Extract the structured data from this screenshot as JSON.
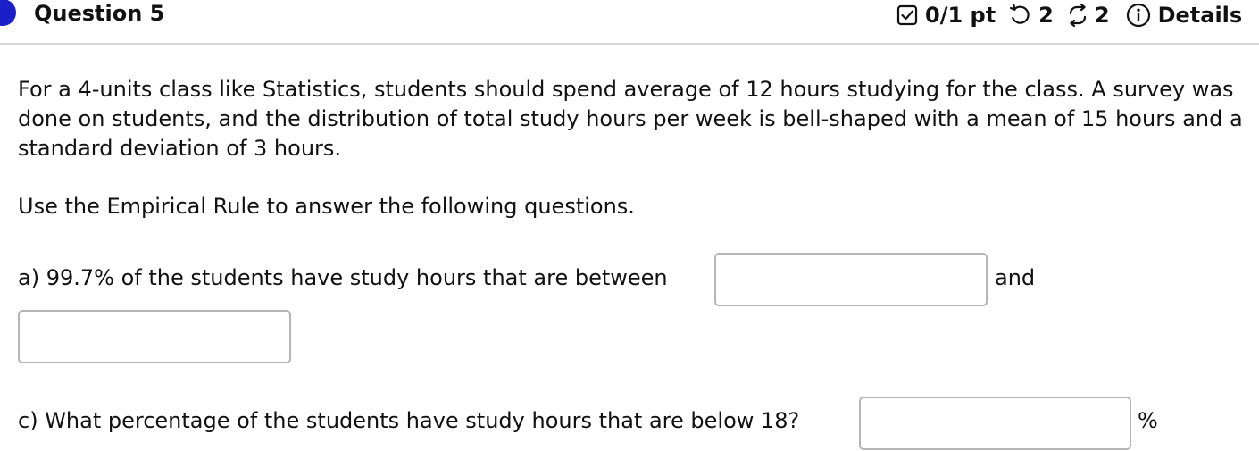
{
  "header": {
    "title": "Question 5",
    "score": "0/1 pt",
    "retries": "2",
    "attempts": "2",
    "details_label": "Details"
  },
  "question": {
    "paragraph": "For a 4-units class like Statistics, students should spend average of 12 hours studying for the class. A survey was done on students, and the distribution of total study hours per week is bell-shaped with a mean of 15 hours and a standard deviation of 3 hours.",
    "instruction": "Use the Empirical Rule to answer the following questions.",
    "part_a": "a) 99.7% of the students have study hours that are between",
    "part_a_and": "and",
    "part_c": "c) What percentage of the students have study hours that are below 18?",
    "part_c_unit": "%"
  },
  "inputs": {
    "a_lower": "",
    "a_upper": "",
    "c_percent": ""
  },
  "colors": {
    "status_dot": "#1a1fc8",
    "divider": "#d6d6d6",
    "input_border": "#b5b5b5"
  },
  "icons": [
    "checkbox-icon",
    "retry-icon",
    "attempts-icon",
    "info-icon"
  ]
}
